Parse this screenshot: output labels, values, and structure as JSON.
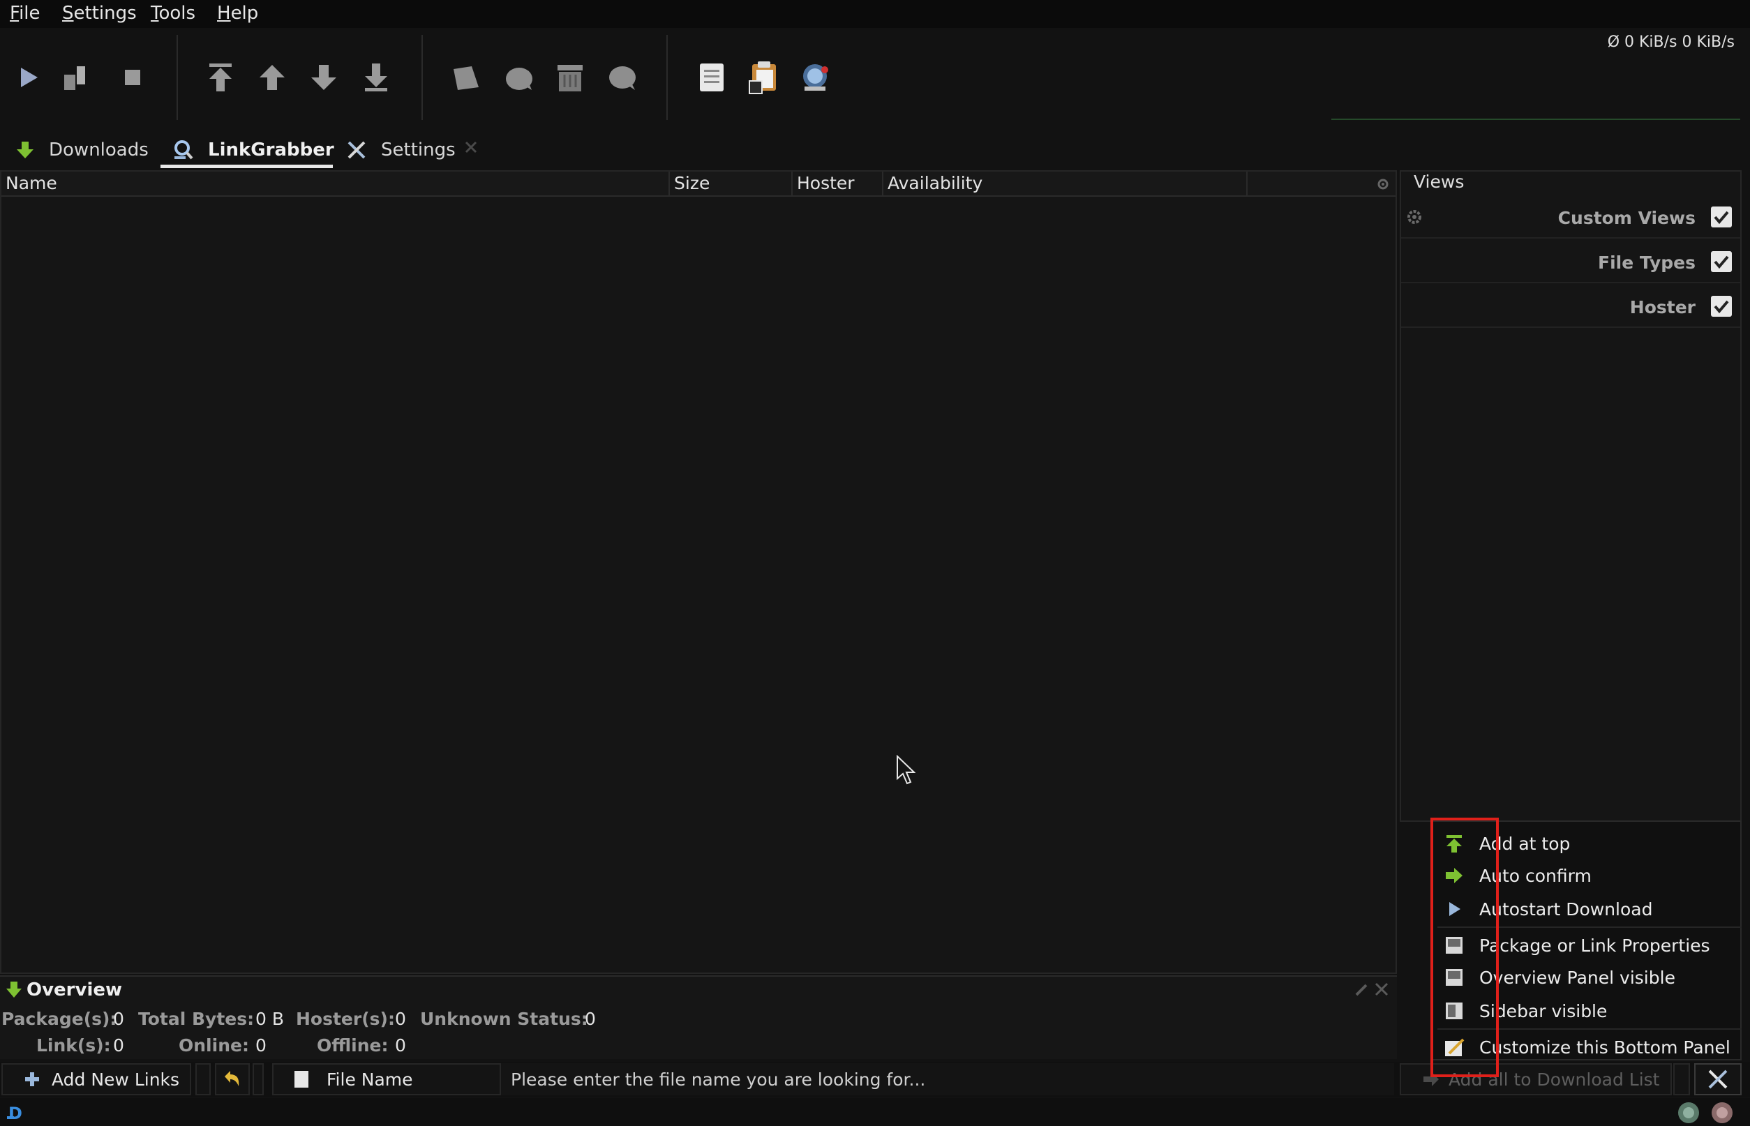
{
  "menu": [
    "File",
    "Settings",
    "Tools",
    "Help"
  ],
  "speed": "Ø 0 KiB/s  0 KiB/s",
  "toolbar": {
    "icons": [
      "play-icon",
      "pause-icon",
      "stop-icon",
      "move-to-top-icon",
      "move-up-icon",
      "move-down-icon",
      "move-to-bottom-icon",
      "reconnect-icon",
      "premium-icon",
      "clear-icon",
      "sleep-icon",
      "clipboard-observer-icon",
      "paste-icon",
      "update-icon"
    ]
  },
  "tabs": [
    {
      "label": "Downloads",
      "icon": "download-arrow-icon"
    },
    {
      "label": "LinkGrabber",
      "icon": "linkgrabber-icon"
    },
    {
      "label": "Settings",
      "icon": "settings-tools-icon"
    }
  ],
  "table": {
    "columns": [
      "Name",
      "Size",
      "Hoster",
      "Availability"
    ],
    "rows": []
  },
  "views": {
    "title": "Views",
    "items": [
      {
        "label": "Custom Views",
        "checked": true
      },
      {
        "label": "File Types",
        "checked": true
      },
      {
        "label": "Hoster",
        "checked": true
      }
    ]
  },
  "overview": {
    "title": "Overview",
    "stats": {
      "packages_label": "Package(s):",
      "packages": "0",
      "total_bytes_label": "Total Bytes:",
      "total_bytes": "0 B",
      "hosters_label": "Hoster(s):",
      "hosters": "0",
      "unknown_label": "Unknown Status:",
      "unknown": "0",
      "links_label": "Link(s):",
      "links": "0",
      "online_label": "Online:",
      "online": "0",
      "offline_label": "Offline:",
      "offline": "0"
    }
  },
  "bottom": {
    "add_new_links": "Add New Links",
    "filter_mode": "File Name",
    "search_placeholder": "Please enter the file name you are looking for...",
    "add_all": "Add all to Download List"
  },
  "context_menu": {
    "items": [
      {
        "label": "Add at top",
        "icon": "add-at-top-icon"
      },
      {
        "label": "Auto confirm",
        "icon": "auto-confirm-icon"
      },
      {
        "label": "Autostart Download",
        "icon": "autostart-icon"
      },
      {
        "label": "Package or Link Properties",
        "icon": "properties-panel-icon"
      },
      {
        "label": "Overview Panel visible",
        "icon": "overview-panel-icon"
      },
      {
        "label": "Sidebar visible",
        "icon": "sidebar-icon"
      },
      {
        "label": "Customize this Bottom Panel",
        "icon": "customize-icon"
      }
    ]
  },
  "colors": {
    "accent_green": "#7ec132",
    "highlight_red": "#e0201a",
    "background": "#121212"
  }
}
